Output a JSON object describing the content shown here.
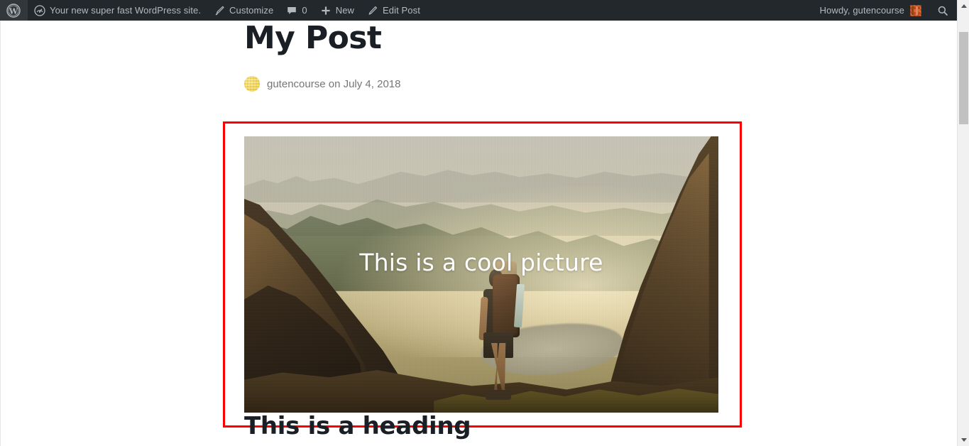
{
  "adminbar": {
    "wp_logo_icon": "wordpress-logo-icon",
    "items": [
      {
        "icon": "dashboard-icon",
        "label": "Your new super fast WordPress site.",
        "name": "site-name-menu"
      },
      {
        "icon": "paintbrush-icon",
        "label": "Customize",
        "name": "customize-menu"
      },
      {
        "icon": "comment-bubble-icon",
        "label": "0",
        "name": "comments-menu"
      },
      {
        "icon": "plus-icon",
        "label": "New",
        "name": "new-content-menu"
      },
      {
        "icon": "pencil-icon",
        "label": "Edit Post",
        "name": "edit-post-menu"
      }
    ],
    "howdy": "Howdy, gutencourse",
    "avatar_icon": "user-avatar",
    "search_icon": "search-icon",
    "background_color": "#23282d",
    "text_color": "#b4b9be"
  },
  "post": {
    "title": "My Post",
    "byline": "gutencourse on July 4, 2018",
    "author": "gutencourse",
    "date": "July 4, 2018",
    "avatar_icon": "author-avatar"
  },
  "image_block": {
    "caption": "This is a cool picture",
    "alt": "Hiker with backpack looking over hazy mountain valley at sunset",
    "selection_color": "#ff0000",
    "selected": true
  },
  "heading": {
    "text": "This is a heading",
    "level": "h2"
  },
  "scrollbar": {
    "up_arrow_icon": "scroll-up-arrow-icon",
    "down_arrow_icon": "scroll-down-arrow-icon",
    "thumb_color": "#c1c1c1",
    "track_color": "#f1f1f1"
  }
}
